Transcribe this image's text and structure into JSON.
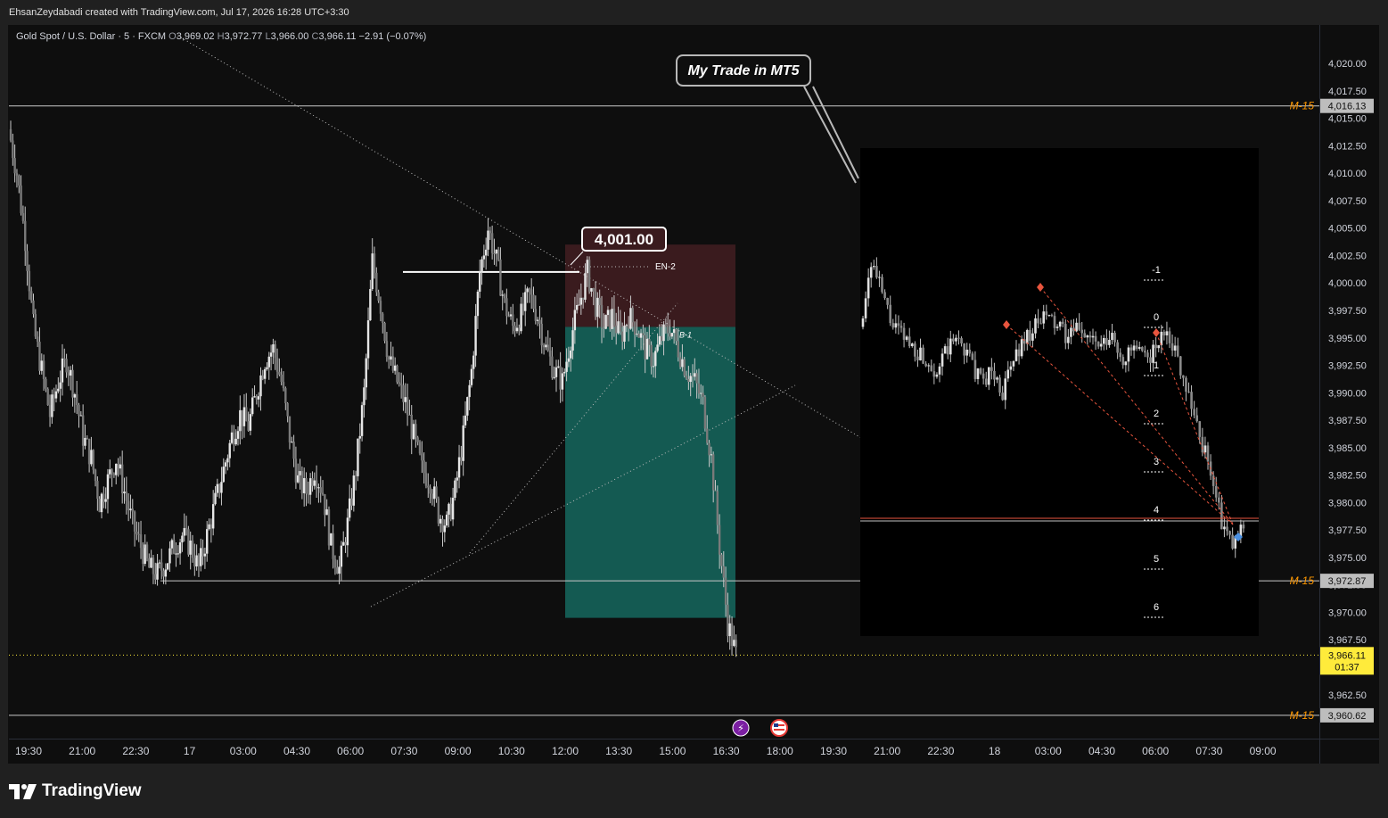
{
  "header": {
    "credit": "EhsanZeydabadi created with TradingView.com, Jul 17, 2026 16:28 UTC+3:30"
  },
  "legend": {
    "symbol": "Gold Spot / U.S. Dollar · 5 · FXCM",
    "open_label": "O",
    "open": "3,969.02",
    "high_label": "H",
    "high": "3,972.77",
    "low_label": "L",
    "low": "3,966.00",
    "close_label": "C",
    "close": "3,966.11",
    "change": "−2.91 (−0.07%)"
  },
  "annotations": {
    "callout": "My Trade in MT5",
    "entry_price_label": "4,001.00",
    "entry_tag": "EN-2",
    "box_tag": "B-1",
    "mt5_levels": [
      "-1",
      "0",
      "1",
      "2",
      "3",
      "4",
      "5",
      "6"
    ]
  },
  "colors": {
    "bg": "#0e0e0e",
    "candle": "#c8c8c8",
    "stop_zone": "#3a1b1e",
    "target_zone": "#145a52",
    "level_label": "#ff9800",
    "last_price": "#ffeb3b",
    "mt5_arrow": "#e8553e"
  },
  "branding": {
    "name": "TradingView"
  },
  "chart_data": {
    "type": "candlestick",
    "symbol": "Gold Spot / U.S. Dollar",
    "ylim": [
      3958.5,
      4023.5
    ],
    "y_ticks": [
      3962.5,
      3965.0,
      3967.5,
      3970.0,
      3972.5,
      3975.0,
      3977.5,
      3980.0,
      3982.5,
      3985.0,
      3987.5,
      3990.0,
      3992.5,
      3995.0,
      3997.5,
      4000.0,
      4002.5,
      4005.0,
      4007.5,
      4010.0,
      4012.5,
      4015.0,
      4017.5,
      4020.0
    ],
    "y_tick_labels": [
      "3,962.50",
      "3,965.00",
      "3,967.50",
      "3,970.00",
      "3,972.50",
      "3,975.00",
      "3,977.50",
      "3,980.00",
      "3,982.50",
      "3,985.00",
      "3,987.50",
      "3,990.00",
      "3,992.50",
      "3,995.00",
      "3,997.50",
      "4,000.00",
      "4,002.50",
      "4,005.00",
      "4,007.50",
      "4,010.00",
      "4,012.50",
      "4,015.00",
      "4,017.50",
      "4,020.00"
    ],
    "x_ticks": [
      "19:30",
      "21:00",
      "22:30",
      "17",
      "03:00",
      "04:30",
      "06:00",
      "07:30",
      "09:00",
      "10:30",
      "12:00",
      "13:30",
      "15:00",
      "16:30",
      "18:00",
      "19:30",
      "21:00",
      "22:30",
      "18",
      "03:00",
      "04:30",
      "06:00",
      "07:30",
      "09:00"
    ],
    "series": [
      {
        "kind": "close_path",
        "points": [
          4014.0,
          4010.0,
          4004.0,
          3996.0,
          3992.0,
          3988.0,
          3991.0,
          3993.0,
          3990.0,
          3986.0,
          3984.0,
          3980.0,
          3982.0,
          3984.0,
          3981.0,
          3978.0,
          3976.0,
          3974.0,
          3973.5,
          3974.5,
          3976.0,
          3977.0,
          3976.0,
          3974.0,
          3977.0,
          3980.0,
          3983.0,
          3986.0,
          3988.0,
          3987.0,
          3990.0,
          3993.0,
          3994.0,
          3991.0,
          3986.0,
          3982.0,
          3981.0,
          3983.0,
          3981.0,
          3976.0,
          3974.0,
          3978.0,
          3983.0,
          3990.0,
          4002.0,
          3998.0,
          3993.0,
          3991.0,
          3989.0,
          3986.0,
          3983.0,
          3982.0,
          3979.0,
          3978.0,
          3981.0,
          3986.0,
          3992.0,
          4001.0,
          4005.0,
          4002.0,
          3998.0,
          3996.0,
          3997.0,
          3999.0,
          3997.0,
          3994.0,
          3992.0,
          3991.0,
          3995.0,
          3998.0,
          4001.0,
          3998.0,
          3996.0,
          3997.0,
          3995.0,
          3997.0,
          3996.0,
          3994.0,
          3993.0,
          3995.0,
          3996.0,
          3994.0,
          3992.0,
          3991.0,
          3989.0,
          3984.0,
          3976.0,
          3969.0,
          3966.11
        ]
      }
    ],
    "horizontal_levels": [
      {
        "label": "M-15",
        "value": 4016.13,
        "price_text": "4,016.13"
      },
      {
        "label": "M-15",
        "value": 3972.87,
        "price_text": "3,972.87"
      },
      {
        "label": "M-15",
        "value": 3960.62,
        "price_text": "3,960.62"
      }
    ],
    "last_price": {
      "value": 3966.11,
      "price_text": "3,966.11",
      "countdown": "01:37"
    },
    "position_tool": {
      "entry": 3996.0,
      "stop": 4003.5,
      "target": 3969.5
    },
    "entry_line": 4001.0
  }
}
